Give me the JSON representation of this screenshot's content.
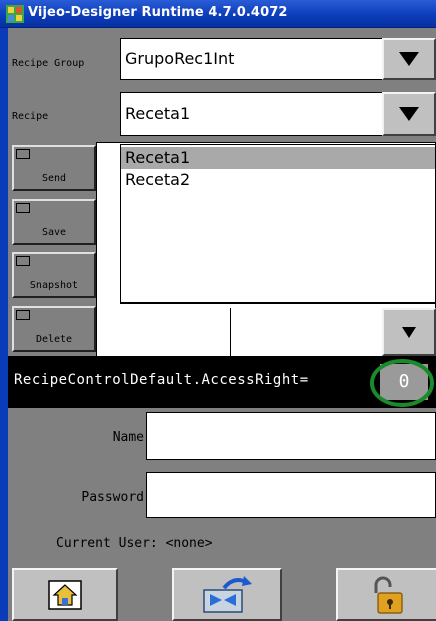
{
  "window": {
    "title": "Vijeo-Designer Runtime 4.7.0.4072",
    "icon": "vijeo-app-icon"
  },
  "recipe_group": {
    "label": "Recipe Group",
    "value": "GrupoRec1Int"
  },
  "recipe": {
    "label": "Recipe",
    "value": "Receta1",
    "options": [
      "Receta1",
      "Receta2"
    ],
    "selected": "Receta1"
  },
  "actions": {
    "send": "Send",
    "save": "Save",
    "snapshot": "Snapshot",
    "delete": "Delete"
  },
  "access": {
    "tag": "RecipeControlDefault.AccessRight=",
    "value": "0",
    "highlight_color": "#1a8a2a"
  },
  "login": {
    "name_label": "Name",
    "password_label": "Password",
    "current_user": "Current User: <none>"
  },
  "toolbar": {
    "home_icon": "home-icon",
    "transfer_icon": "transfer-icon",
    "lock_icon": "padlock-icon"
  }
}
